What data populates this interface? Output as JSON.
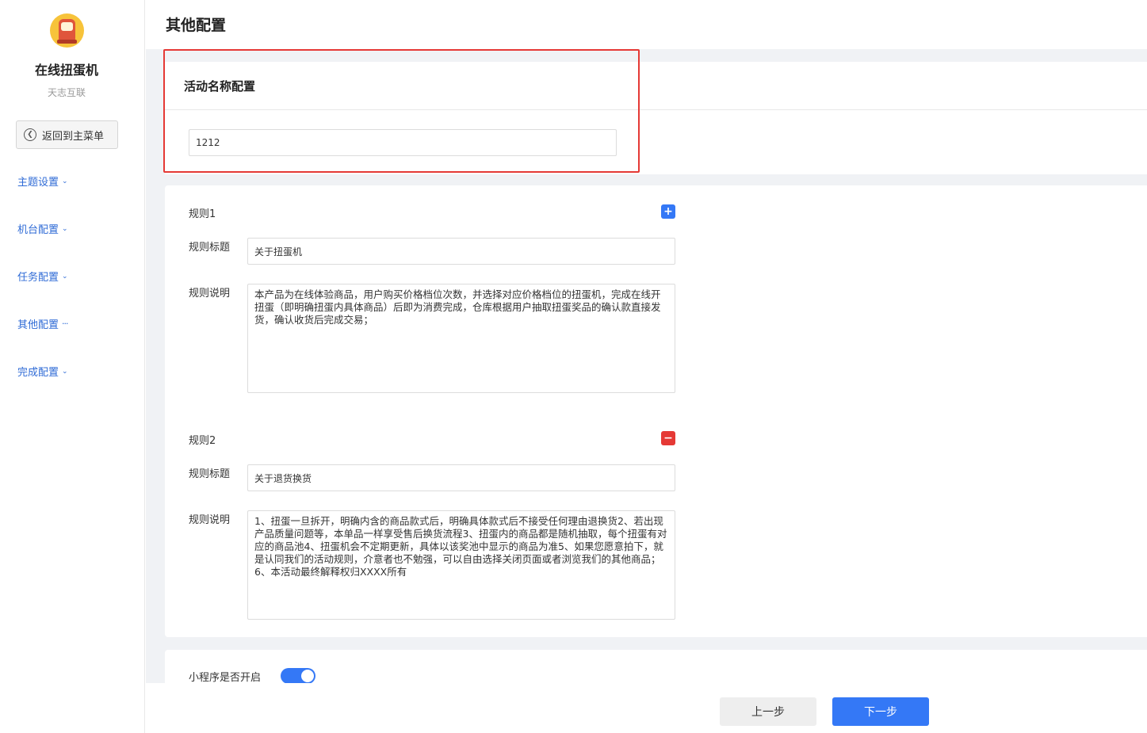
{
  "sidebar": {
    "app_title": "在线扭蛋机",
    "app_subtitle": "天志互联",
    "back_label": "返回到主菜单",
    "items": [
      {
        "label": "主题设置"
      },
      {
        "label": "机台配置"
      },
      {
        "label": "任务配置"
      },
      {
        "label": "其他配置"
      },
      {
        "label": "完成配置"
      }
    ]
  },
  "header": {
    "title": "其他配置"
  },
  "activity_name": {
    "title": "活动名称配置",
    "value": "1212"
  },
  "rules": [
    {
      "heading": "规则1",
      "title_label": "规则标题",
      "title_value": "关于扭蛋机",
      "desc_label": "规则说明",
      "desc_value": "本产品为在线体验商品，用户购买价格档位次数，并选择对应价格档位的扭蛋机，完成在线开扭蛋（即明确扭蛋内具体商品）后即为消费完成，仓库根据用户抽取扭蛋奖品的确认款直接发货，确认收货后完成交易；",
      "action": "add"
    },
    {
      "heading": "规则2",
      "title_label": "规则标题",
      "title_value": "关于退货换货",
      "desc_label": "规则说明",
      "desc_value": "1、扭蛋一旦拆开，明确内含的商品款式后，明确具体款式后不接受任何理由退换货2、若出现产品质量问题等，本单品一样享受售后换货流程3、扭蛋内的商品都是随机抽取，每个扭蛋有对应的商品池4、扭蛋机会不定期更新，具体以该奖池中显示的商品为准5、如果您愿意拍下，就是认同我们的活动规则，介意者也不勉强，可以自由选择关闭页面或者浏览我们的其他商品；6、本活动最终解释权归XXXX所有",
      "action": "remove"
    }
  ],
  "miniprogram": {
    "label": "小程序是否开启",
    "enabled": true
  },
  "footer": {
    "prev_label": "上一步",
    "next_label": "下一步"
  },
  "colors": {
    "accent": "#3478f6",
    "highlight": "#e53935",
    "link": "#2f6bd6",
    "remove": "#e53935"
  }
}
